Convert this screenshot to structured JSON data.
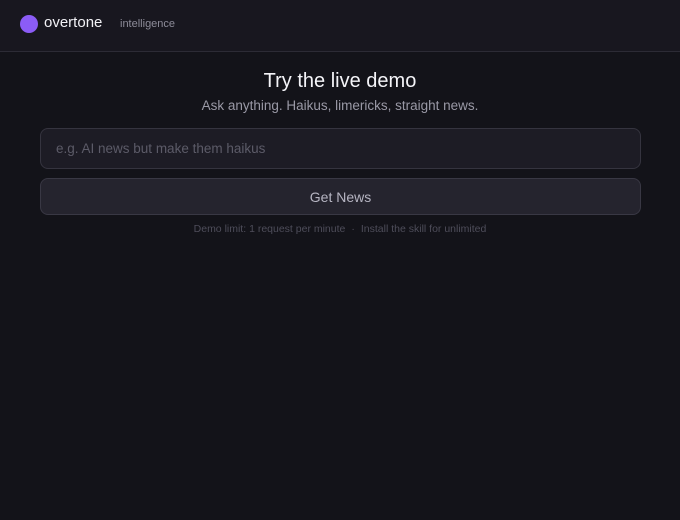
{
  "header": {
    "brand_name": "overtone",
    "brand_tag": "intelligence",
    "logo_icon": "purple-circle-logo",
    "accent_color": "#8b5cf6"
  },
  "demo": {
    "title": "Try the live demo",
    "subtitle": "Ask anything. Haikus, limericks, straight news.",
    "input_value": "",
    "input_placeholder": "e.g. AI news but make them haikus",
    "button_label": "Get News",
    "limit_text": "Demo limit: 1 request per minute",
    "separator": "·",
    "install_text": "Install the skill for unlimited"
  }
}
